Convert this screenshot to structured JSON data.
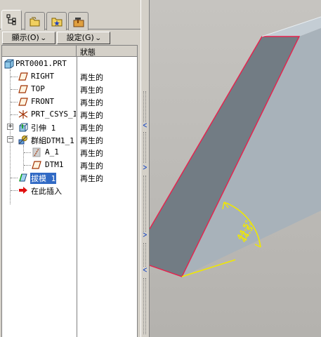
{
  "tabs": [
    {
      "icon": "model-tree-icon",
      "active": true
    },
    {
      "icon": "folder-browser-icon",
      "active": false
    },
    {
      "icon": "favorites-folder-icon",
      "active": false
    },
    {
      "icon": "tools-hammer-icon",
      "active": false
    }
  ],
  "toolbar": {
    "show_label": "顯示(O)",
    "settings_label": "設定(G)"
  },
  "tree": {
    "status_header": "狀態",
    "root": "PRT0001.PRT",
    "items": [
      {
        "label": "RIGHT",
        "status": "再生的",
        "icon": "datum-plane-icon"
      },
      {
        "label": "TOP",
        "status": "再生的",
        "icon": "datum-plane-icon"
      },
      {
        "label": "FRONT",
        "status": "再生的",
        "icon": "datum-plane-icon"
      },
      {
        "label": "PRT_CSYS_I",
        "status": "再生的",
        "icon": "coordinate-system-icon"
      },
      {
        "label": "引伸 1",
        "status": "再生的",
        "icon": "extrude-icon"
      },
      {
        "label": "群組DTM1_1",
        "status": "再生的",
        "icon": "group-icon"
      },
      {
        "label": "A_1",
        "status": "再生的",
        "icon": "datum-axis-icon"
      },
      {
        "label": "DTM1",
        "status": "再生的",
        "icon": "datum-plane-icon"
      },
      {
        "label": "拔模 1",
        "status": "再生的",
        "icon": "draft-icon"
      },
      {
        "label": "在此插入",
        "status": "",
        "icon": "insert-here-arrow-icon"
      }
    ]
  },
  "viewport": {
    "dimension_text": "44.5°",
    "colors": {
      "background": "#bcbab6",
      "front_face": "#727c84",
      "side_face": "#a8b2ba",
      "top_face": "#c4cdd4",
      "edge_highlight": "#e8204c",
      "dimension": "#f0e800"
    }
  }
}
